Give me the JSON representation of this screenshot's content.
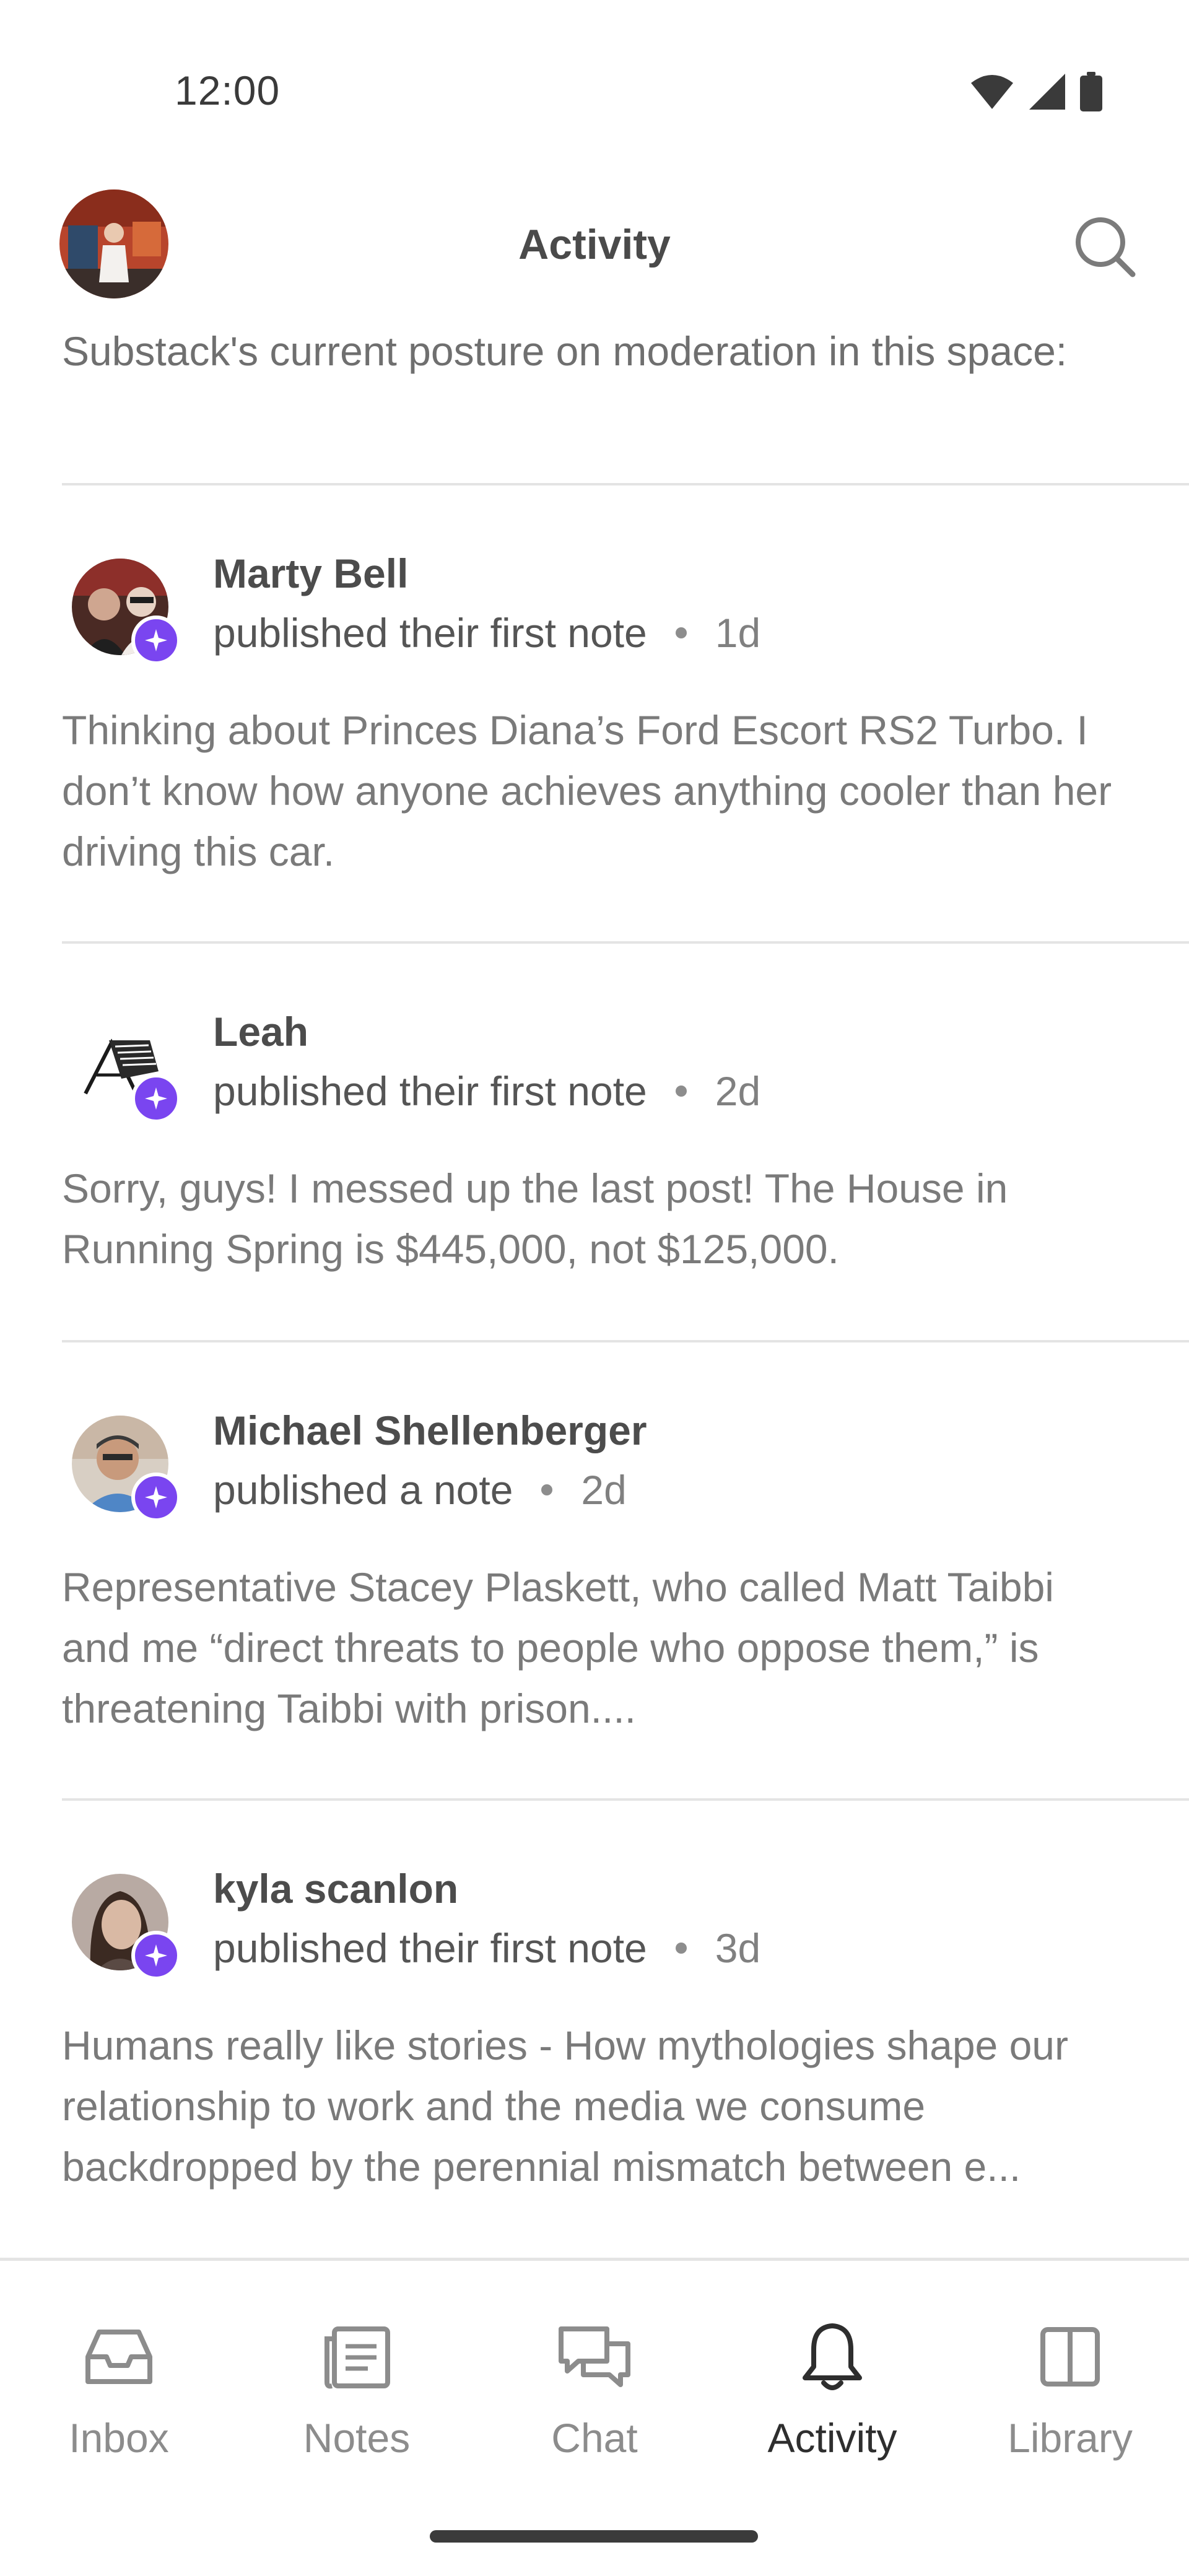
{
  "status_bar": {
    "time": "12:00"
  },
  "header": {
    "title": "Activity"
  },
  "feed": {
    "truncated_text": "Substack's current posture on moderation in this space:",
    "items": [
      {
        "name": "Marty Bell",
        "action": "published their first note",
        "time": "1d",
        "body": "Thinking about Princes Diana’s Ford Escort RS2 Turbo. I don’t know how anyone achieves anything cooler than her driving this car."
      },
      {
        "name": "Leah",
        "action": "published their first note",
        "time": "2d",
        "body": "Sorry, guys! I messed up the last post! The House in Running Spring is $445,000, not $125,000."
      },
      {
        "name": "Michael Shellenberger",
        "action": "published a note",
        "time": "2d",
        "body": "Representative Stacey Plaskett, who called Matt Taibbi and me “direct threats to people who oppose them,” is  threatening Taibbi with prison...."
      },
      {
        "name": "kyla scanlon",
        "action": "published their first note",
        "time": "3d",
        "body": "Humans really like stories - How mythologies shape our relationship to work and the media we consume backdropped by the perennial mismatch between e..."
      }
    ]
  },
  "bottom_nav": {
    "items": [
      {
        "label": "Inbox",
        "icon": "inbox-icon"
      },
      {
        "label": "Notes",
        "icon": "notes-icon"
      },
      {
        "label": "Chat",
        "icon": "chat-icon"
      },
      {
        "label": "Activity",
        "icon": "bell-icon",
        "active": true
      },
      {
        "label": "Library",
        "icon": "library-icon"
      }
    ]
  },
  "colors": {
    "accent": "#7a45f0",
    "separator": "#e4e4e4",
    "text_primary": "#4c4c4c",
    "text_secondary": "#7a7a7a"
  }
}
